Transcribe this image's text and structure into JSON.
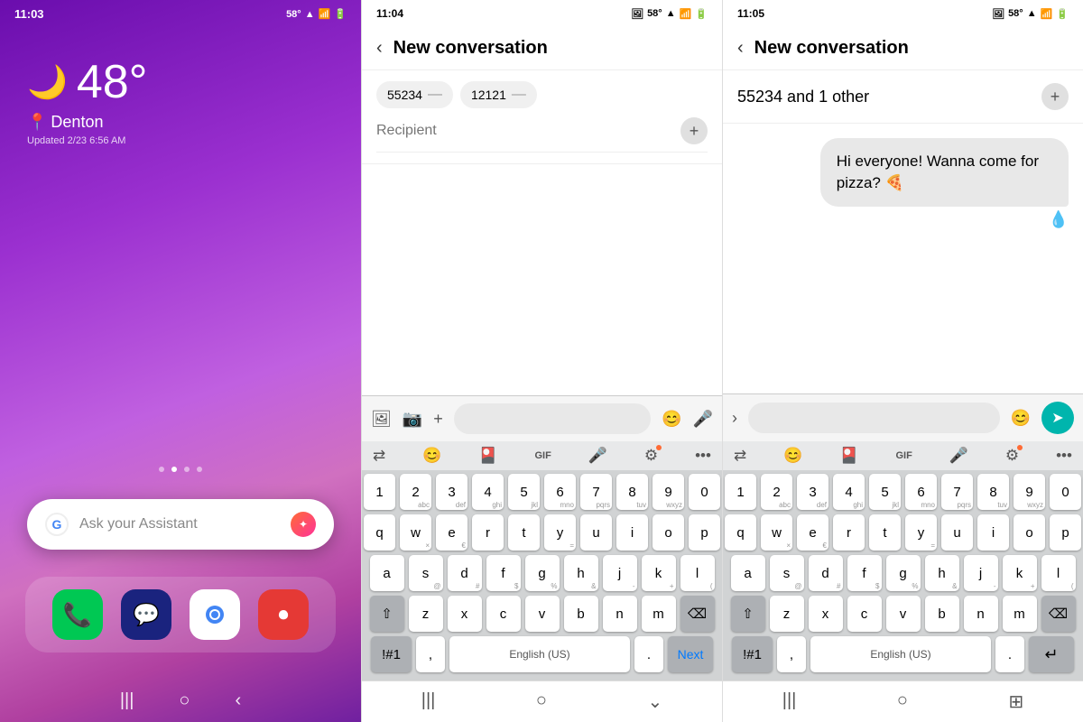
{
  "panel1": {
    "status_time": "11:03",
    "status_temp": "58°",
    "weather_emoji": "🌙",
    "temperature": "48°",
    "location": "Denton",
    "updated": "Updated 2/23 6:56 AM",
    "assistant_placeholder": "Ask your Assistant",
    "dots": [
      "",
      "",
      "",
      ""
    ],
    "dock_icons": [
      "📞",
      "💬",
      "",
      "⏺"
    ],
    "nav_icons": [
      "|||",
      "○",
      "‹"
    ]
  },
  "panel2": {
    "status_time": "11:04",
    "status_temp": "58°",
    "header_title": "New conversation",
    "chip1": "55234",
    "chip2": "12121",
    "recipient_placeholder": "Recipient",
    "keyboard": {
      "numbers": [
        "1",
        "2",
        "3",
        "4",
        "5",
        "6",
        "7",
        "8",
        "9",
        "0"
      ],
      "row1": [
        "q",
        "w",
        "e",
        "r",
        "t",
        "y",
        "u",
        "i",
        "o",
        "p"
      ],
      "row2": [
        "a",
        "s",
        "d",
        "f",
        "g",
        "h",
        "j",
        "k",
        "l"
      ],
      "row3": [
        "z",
        "x",
        "c",
        "v",
        "b",
        "n",
        "m"
      ],
      "special": "!#1",
      "comma": ",",
      "space": "English (US)",
      "period": ".",
      "next": "Next"
    },
    "nav_icons": [
      "|||",
      "○",
      "⌄"
    ]
  },
  "panel3": {
    "status_time": "11:05",
    "status_temp": "58°",
    "header_title": "New conversation",
    "recipients_text": "55234 and 1 other",
    "bubble_text": "Hi everyone! Wanna come for pizza? 🍕",
    "drop": "💧",
    "keyboard": {
      "numbers": [
        "1",
        "2",
        "3",
        "4",
        "5",
        "6",
        "7",
        "8",
        "9",
        "0"
      ],
      "row1": [
        "q",
        "w",
        "e",
        "r",
        "t",
        "y",
        "u",
        "i",
        "o",
        "p"
      ],
      "row2": [
        "a",
        "s",
        "d",
        "f",
        "g",
        "h",
        "j",
        "k",
        "l"
      ],
      "row3": [
        "z",
        "x",
        "c",
        "v",
        "b",
        "n",
        "m"
      ],
      "special": "!#1",
      "comma": ",",
      "space": "English (US)",
      "period": ".",
      "enter": "↵"
    },
    "nav_icons": [
      "|||",
      "○",
      "⊞"
    ]
  }
}
